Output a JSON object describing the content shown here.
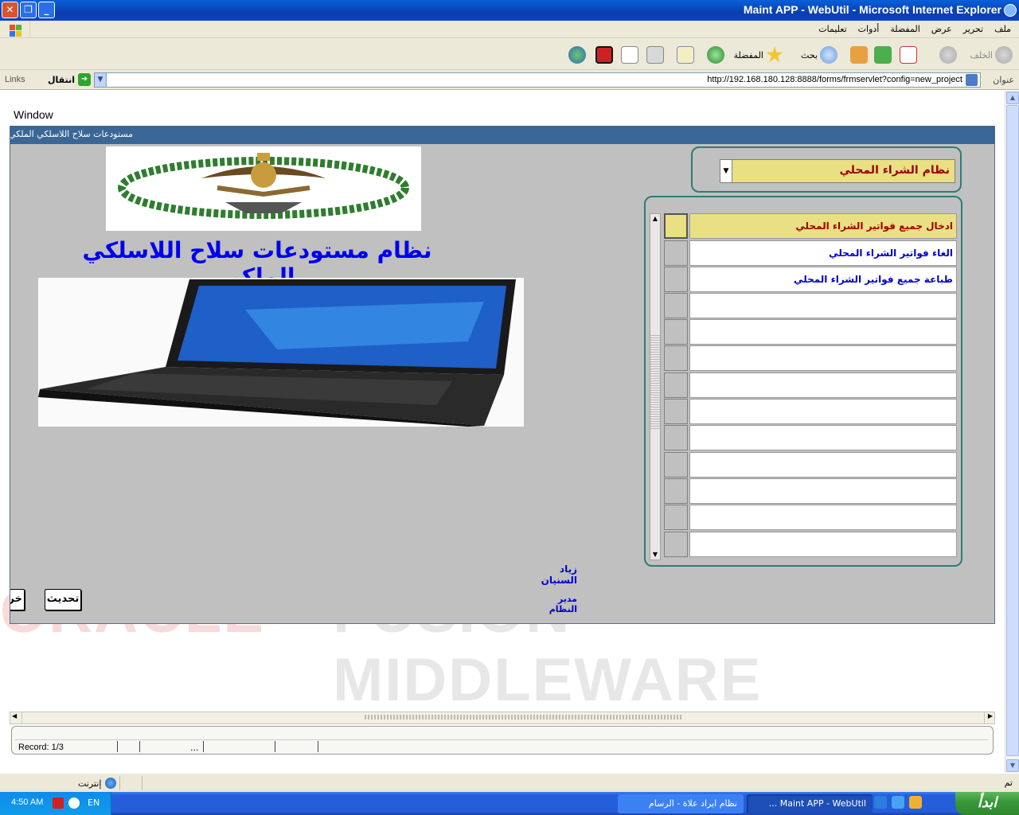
{
  "window": {
    "title": "Maint APP - WebUtil - Microsoft Internet Explorer"
  },
  "menubar": {
    "items": [
      "ملف",
      "تحرير",
      "عرض",
      "المفضلة",
      "أدوات",
      "تعليمات"
    ]
  },
  "toolbar": {
    "back_label": "الخلف",
    "search_label": "بحث",
    "favorites_label": "المفضلة"
  },
  "addressbar": {
    "label": "عنوان",
    "url": "http://192.168.180.128:8888/forms/frmservlet?config=new_project",
    "go_label": "انتقال",
    "links_label": "Links"
  },
  "applet": {
    "window_menu": "Window",
    "form_title": "مستودعات سلاح اللاسلكي الملكي",
    "heading": "نظام مستودعات سلاح اللاسلكي الملكي",
    "system_select": {
      "value": "نظام الشراء المحلي"
    },
    "menu_items": [
      "ادخال جميع فواتير الشراء المحلي",
      "الغاء فواتير الشراء المحلي",
      "طباعة جميع فواتير الشراء المحلي",
      "",
      "",
      "",
      "",
      "",
      "",
      "",
      "",
      "",
      ""
    ],
    "developer_name": "زياد السنيان",
    "developer_role": "مدير النظام",
    "refresh_button": "تحديث",
    "exit_button": "خروج",
    "record_status": "Record: 1/3",
    "record_dots": "...",
    "watermark": {
      "line1_red": "ORACLE",
      "line1_gray": "FUSION",
      "line2": "MIDDLEWARE"
    }
  },
  "statusbar": {
    "done": "تم",
    "zone": "إنترنت"
  },
  "taskbar": {
    "start_label": "ابدأ",
    "tasks": [
      "Maint APP - WebUtil ...",
      "نظام ايراد علاة - الرسام"
    ],
    "clock": "4:50 AM",
    "language": "EN"
  },
  "colors": {
    "form_title_bar": "#3a6795",
    "form_background": "#c0c0c0",
    "selected_item": "#e8e082",
    "heading_blue": "#0000ee",
    "group_border": "#2e7b76"
  }
}
